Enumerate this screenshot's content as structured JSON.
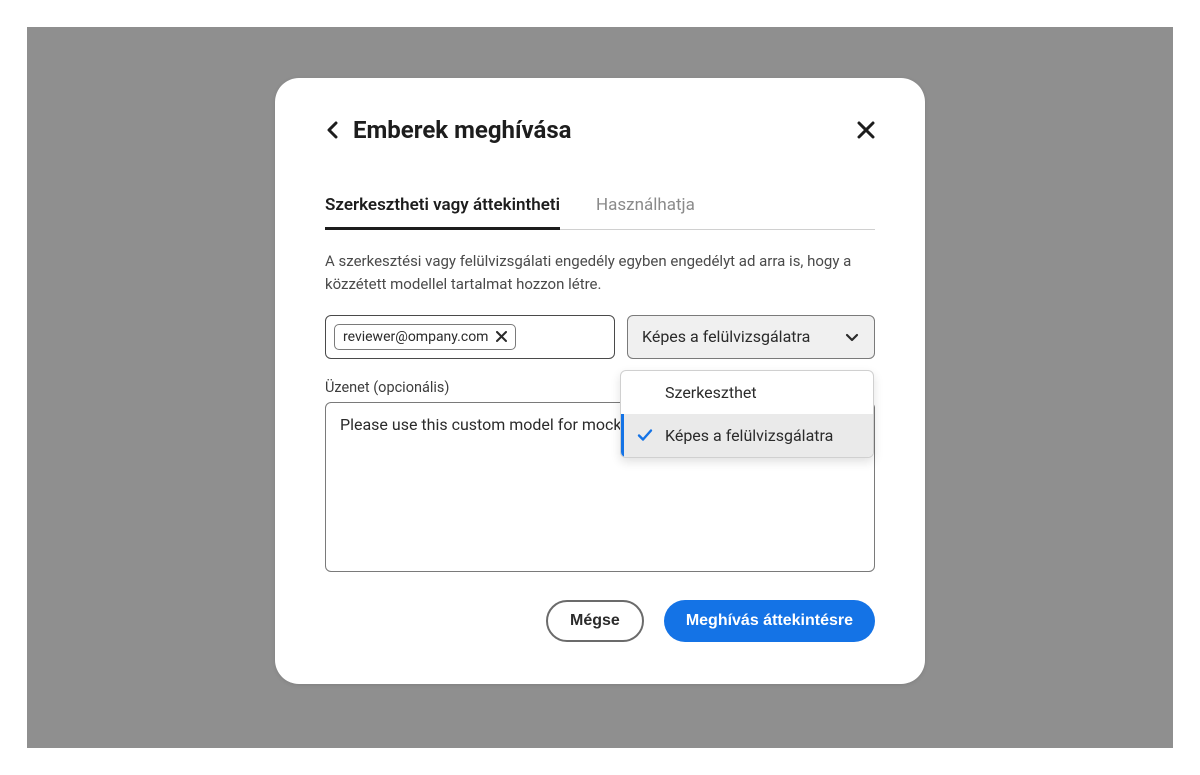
{
  "modal": {
    "title": "Emberek meghívása"
  },
  "tabs": {
    "edit_or_review": "Szerkesztheti vagy áttekintheti",
    "can_use": "Használhatja"
  },
  "helper_text": "A szerkesztési vagy felülvizsgálati engedély egyben engedélyt ad arra is, hogy a közzétett modellel tartalmat hozzon létre.",
  "invitee_chip": {
    "email": "reviewer@ompany.com"
  },
  "permission_select": {
    "current": "Képes a felülvizsgálatra",
    "options": {
      "can_edit": "Szerkeszthet",
      "can_review": "Képes a felülvizsgálatra"
    }
  },
  "message": {
    "label": "Üzenet (opcionális)",
    "value": "Please use this custom model for mock-ups only."
  },
  "buttons": {
    "cancel": "Mégse",
    "invite": "Meghívás áttekintésre"
  }
}
